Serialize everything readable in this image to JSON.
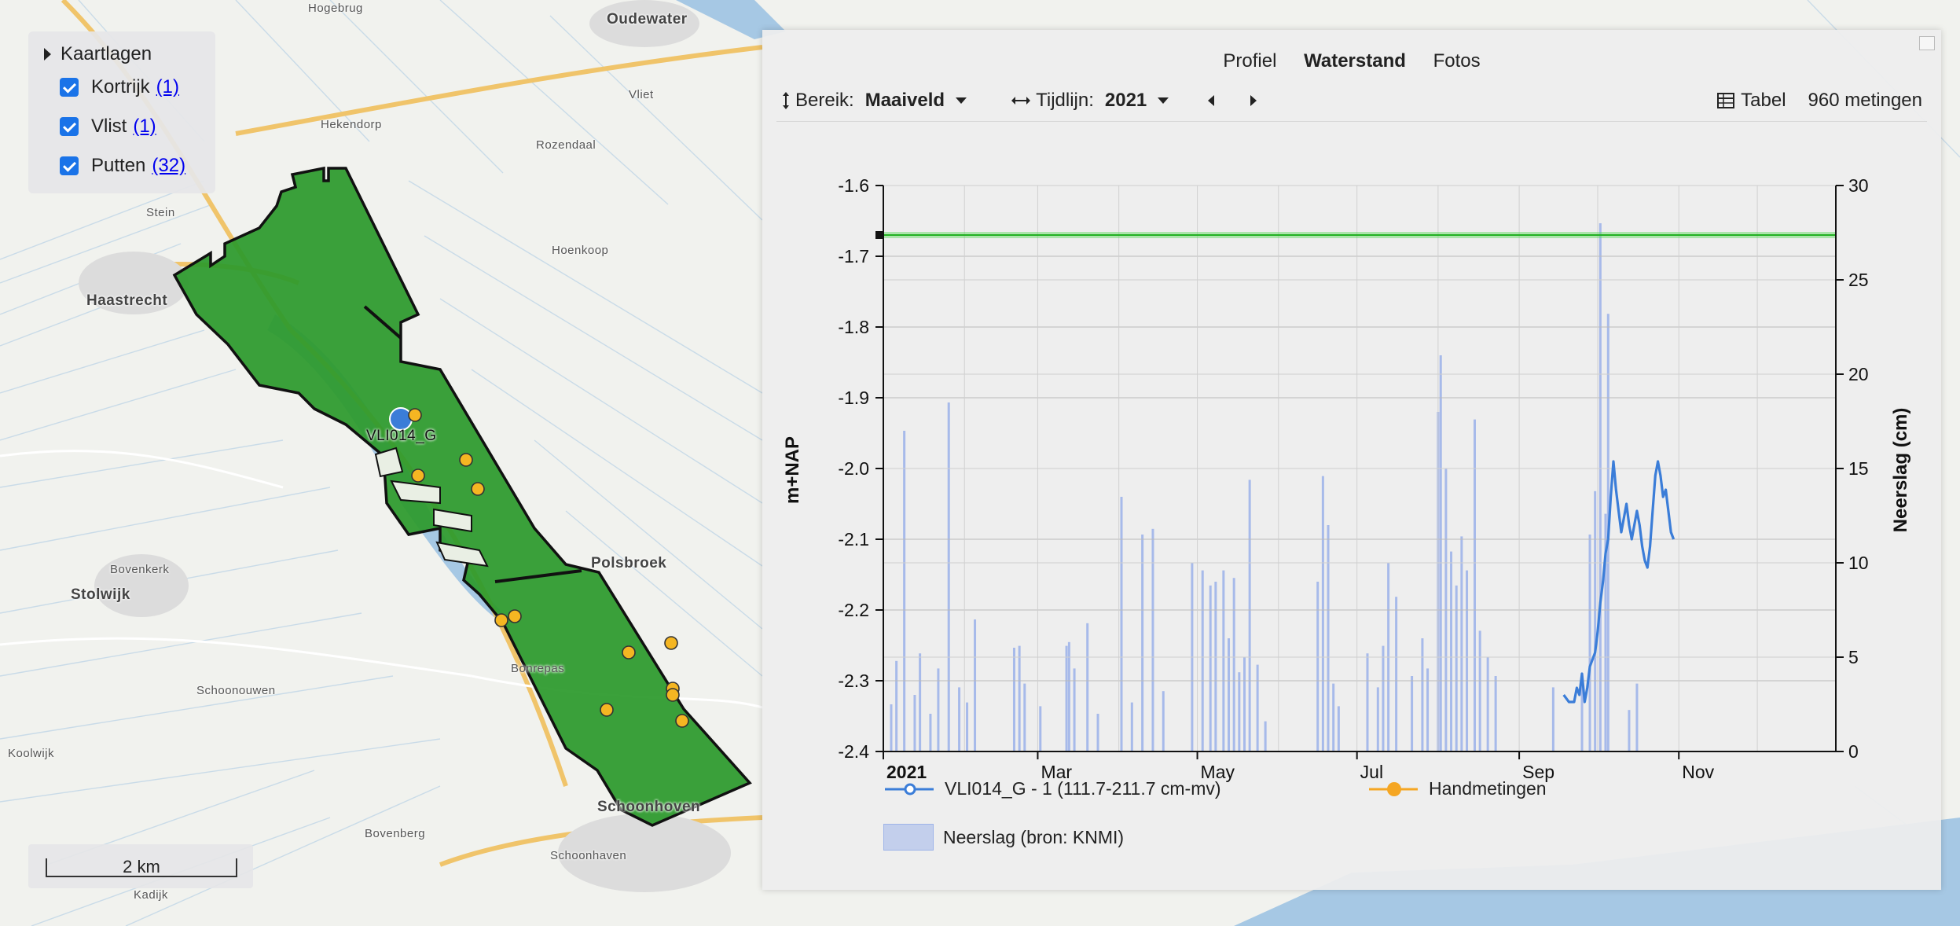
{
  "map": {
    "labels": [
      {
        "text": "Hogebrug",
        "cls": ""
      },
      {
        "text": "Oudewater",
        "cls": "bold"
      },
      {
        "text": "Hekendorp",
        "cls": ""
      },
      {
        "text": "Rozendaal",
        "cls": ""
      },
      {
        "text": "Vliet",
        "cls": ""
      },
      {
        "text": "Stein",
        "cls": ""
      },
      {
        "text": "Hoenkoop",
        "cls": ""
      },
      {
        "text": "Haastrecht",
        "cls": "bold"
      },
      {
        "text": "Polsbroek",
        "cls": "bold"
      },
      {
        "text": "Bovenkerk",
        "cls": ""
      },
      {
        "text": "Stolwijk",
        "cls": "bold"
      },
      {
        "text": "Schoonouwen",
        "cls": ""
      },
      {
        "text": "Bonrepas",
        "cls": ""
      },
      {
        "text": "Schoonhoven",
        "cls": "bold"
      },
      {
        "text": "Koolwijk",
        "cls": ""
      },
      {
        "text": "Bovenberg",
        "cls": ""
      },
      {
        "text": "Kadijk",
        "cls": ""
      },
      {
        "text": "Schoonhaven",
        "cls": ""
      }
    ],
    "well_label": "VLI014_G",
    "colors": {
      "polygon": "#2c9a2c",
      "well": "#f5b622",
      "selected_well": "#3b7dd8"
    }
  },
  "layers": {
    "title": "Kaartlagen",
    "items": [
      {
        "label": "Kortrijk",
        "count": "(1)"
      },
      {
        "label": "Vlist",
        "count": "(1)"
      },
      {
        "label": "Putten",
        "count": "(32)"
      }
    ]
  },
  "scale": {
    "label": "2 km"
  },
  "panel": {
    "tabs": [
      "Profiel",
      "Waterstand",
      "Fotos"
    ],
    "active_tab": "Waterstand",
    "toolbar": {
      "range_label": "Bereik:",
      "range_value": "Maaiveld",
      "timeline_label": "Tijdlijn:",
      "timeline_value": "2021",
      "table_label": "Tabel",
      "measurements": "960 metingen"
    }
  },
  "chart_data": {
    "type": "line",
    "ylabel": "m+NAP",
    "ylabel_right": "Neerslag (cm)",
    "ylim": [
      -2.4,
      -1.6
    ],
    "yticks": [
      "-1.6",
      "-1.7",
      "-1.8",
      "-1.9",
      "-2.0",
      "-2.1",
      "-2.2",
      "-2.3",
      "-2.4"
    ],
    "ylim_right": [
      0,
      30
    ],
    "yticks_right": [
      "30",
      "25",
      "20",
      "15",
      "10",
      "5",
      "0"
    ],
    "x_ticks": [
      "2021",
      "Mar",
      "May",
      "Jul",
      "Sep",
      "Nov"
    ],
    "xlim": [
      "2021-01-01",
      "2021-12-31"
    ],
    "maaiveld_level": -1.67,
    "grid": true,
    "legend_position": "bottom",
    "series": [
      {
        "name": "VLI014_G - 1 (111.7-211.7 cm-mv)",
        "color": "#3b7dd8",
        "points": [
          [
            "2021-09-18",
            -2.32
          ],
          [
            "2021-09-20",
            -2.33
          ],
          [
            "2021-09-22",
            -2.33
          ],
          [
            "2021-09-23",
            -2.31
          ],
          [
            "2021-09-24",
            -2.32
          ],
          [
            "2021-09-25",
            -2.29
          ],
          [
            "2021-09-26",
            -2.33
          ],
          [
            "2021-09-27",
            -2.31
          ],
          [
            "2021-09-28",
            -2.28
          ],
          [
            "2021-09-30",
            -2.26
          ],
          [
            "2021-10-01",
            -2.23
          ],
          [
            "2021-10-02",
            -2.19
          ],
          [
            "2021-10-03",
            -2.16
          ],
          [
            "2021-10-04",
            -2.12
          ],
          [
            "2021-10-05",
            -2.1
          ],
          [
            "2021-10-06",
            -2.04
          ],
          [
            "2021-10-07",
            -1.99
          ],
          [
            "2021-10-08",
            -2.03
          ],
          [
            "2021-10-09",
            -2.06
          ],
          [
            "2021-10-10",
            -2.09
          ],
          [
            "2021-10-11",
            -2.07
          ],
          [
            "2021-10-12",
            -2.05
          ],
          [
            "2021-10-13",
            -2.08
          ],
          [
            "2021-10-14",
            -2.1
          ],
          [
            "2021-10-15",
            -2.08
          ],
          [
            "2021-10-16",
            -2.06
          ],
          [
            "2021-10-17",
            -2.08
          ],
          [
            "2021-10-18",
            -2.11
          ],
          [
            "2021-10-19",
            -2.13
          ],
          [
            "2021-10-20",
            -2.14
          ],
          [
            "2021-10-21",
            -2.11
          ],
          [
            "2021-10-22",
            -2.06
          ],
          [
            "2021-10-23",
            -2.01
          ],
          [
            "2021-10-24",
            -1.99
          ],
          [
            "2021-10-25",
            -2.01
          ],
          [
            "2021-10-26",
            -2.04
          ],
          [
            "2021-10-27",
            -2.03
          ],
          [
            "2021-10-28",
            -2.06
          ],
          [
            "2021-10-29",
            -2.09
          ],
          [
            "2021-10-30",
            -2.1
          ]
        ]
      },
      {
        "name": "Handmetingen",
        "color": "#f5a623",
        "points": []
      }
    ],
    "rain": {
      "name": "Neerslag (bron: KNMI)",
      "color": "#8fa8e8",
      "bars": [
        [
          "2021-01-04",
          2.5
        ],
        [
          "2021-01-06",
          4.8
        ],
        [
          "2021-01-09",
          17.0
        ],
        [
          "2021-01-13",
          3.0
        ],
        [
          "2021-01-15",
          5.2
        ],
        [
          "2021-01-19",
          2.0
        ],
        [
          "2021-01-22",
          4.4
        ],
        [
          "2021-01-26",
          18.5
        ],
        [
          "2021-01-30",
          3.4
        ],
        [
          "2021-02-02",
          2.6
        ],
        [
          "2021-02-05",
          7.0
        ],
        [
          "2021-02-20",
          5.5
        ],
        [
          "2021-02-22",
          5.6
        ],
        [
          "2021-02-24",
          3.6
        ],
        [
          "2021-03-02",
          2.4
        ],
        [
          "2021-03-12",
          5.6
        ],
        [
          "2021-03-13",
          5.8
        ],
        [
          "2021-03-15",
          4.4
        ],
        [
          "2021-03-20",
          6.8
        ],
        [
          "2021-03-24",
          2.0
        ],
        [
          "2021-04-02",
          13.5
        ],
        [
          "2021-04-06",
          2.6
        ],
        [
          "2021-04-10",
          11.5
        ],
        [
          "2021-04-14",
          11.8
        ],
        [
          "2021-04-18",
          3.2
        ],
        [
          "2021-04-29",
          10.0
        ],
        [
          "2021-05-03",
          9.6
        ],
        [
          "2021-05-06",
          8.8
        ],
        [
          "2021-05-08",
          9.0
        ],
        [
          "2021-05-11",
          9.6
        ],
        [
          "2021-05-13",
          6.0
        ],
        [
          "2021-05-15",
          9.2
        ],
        [
          "2021-05-17",
          4.2
        ],
        [
          "2021-05-19",
          5.0
        ],
        [
          "2021-05-21",
          14.4
        ],
        [
          "2021-05-24",
          4.6
        ],
        [
          "2021-05-27",
          1.6
        ],
        [
          "2021-06-16",
          9.0
        ],
        [
          "2021-06-18",
          14.6
        ],
        [
          "2021-06-20",
          12.0
        ],
        [
          "2021-06-22",
          3.6
        ],
        [
          "2021-06-24",
          2.4
        ],
        [
          "2021-07-05",
          5.2
        ],
        [
          "2021-07-09",
          3.4
        ],
        [
          "2021-07-11",
          5.6
        ],
        [
          "2021-07-13",
          10.0
        ],
        [
          "2021-07-16",
          8.2
        ],
        [
          "2021-07-22",
          4.0
        ],
        [
          "2021-07-26",
          6.0
        ],
        [
          "2021-07-28",
          4.4
        ],
        [
          "2021-08-01",
          18.0
        ],
        [
          "2021-08-02",
          21.0
        ],
        [
          "2021-08-04",
          15.0
        ],
        [
          "2021-08-06",
          10.6
        ],
        [
          "2021-08-08",
          8.8
        ],
        [
          "2021-08-10",
          11.4
        ],
        [
          "2021-08-12",
          9.6
        ],
        [
          "2021-08-15",
          17.6
        ],
        [
          "2021-08-17",
          6.4
        ],
        [
          "2021-08-20",
          5.0
        ],
        [
          "2021-08-23",
          4.0
        ],
        [
          "2021-09-14",
          3.4
        ],
        [
          "2021-09-25",
          4.0
        ],
        [
          "2021-09-28",
          11.5
        ],
        [
          "2021-09-30",
          13.8
        ],
        [
          "2021-10-02",
          28.0
        ],
        [
          "2021-10-04",
          12.6
        ],
        [
          "2021-10-05",
          23.2
        ],
        [
          "2021-10-13",
          2.2
        ],
        [
          "2021-10-16",
          3.6
        ]
      ]
    },
    "legend": [
      "VLI014_G - 1 (111.7-211.7 cm-mv)",
      "Handmetingen",
      "Neerslag (bron: KNMI)"
    ]
  }
}
